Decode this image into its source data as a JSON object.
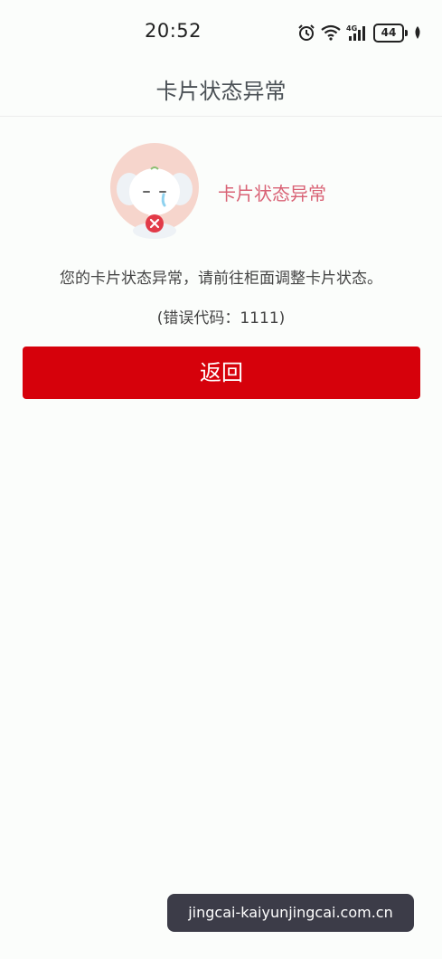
{
  "status_bar": {
    "time": "20:52",
    "icons": [
      "alarm-icon",
      "wifi-icon",
      "signal-4g-icon",
      "battery-icon",
      "leaf-icon"
    ],
    "network_label": "4G",
    "battery_level": "44"
  },
  "nav": {
    "title": "卡片状态异常"
  },
  "status": {
    "heading": "卡片状态异常",
    "mascot": "crying-elephant-with-error-icon",
    "message": "您的卡片状态异常，请前往柜面调整卡片状态。",
    "error_code": "(错误代码：1111)"
  },
  "actions": {
    "back_label": "返回"
  },
  "watermark": {
    "text": "jingcai-kaiyunjingcai.com.cn"
  },
  "colors": {
    "primary_button": "#d6010b",
    "heading_pink": "#d96275",
    "mascot_circle": "#f6d5cc",
    "error_badge": "#e23a48"
  }
}
